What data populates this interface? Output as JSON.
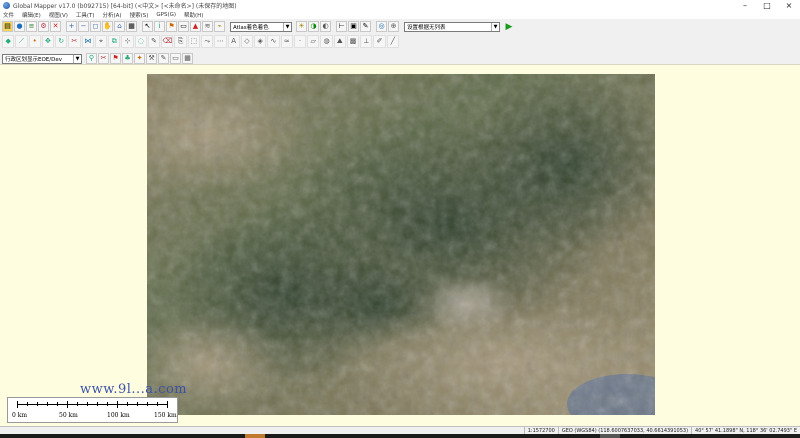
{
  "window": {
    "title": "Global Mapper v17.0 (b092715) [64-bit] (<中文> [<未命名>] (未保存的地图)"
  },
  "menu": [
    {
      "label": "文件"
    },
    {
      "label": "编辑(E)"
    },
    {
      "label": "视图(V)"
    },
    {
      "label": "工具(T)"
    },
    {
      "label": "分析(A)"
    },
    {
      "label": "搜索(S)"
    },
    {
      "label": "GPS(G)"
    },
    {
      "label": "帮助(H)"
    }
  ],
  "toolbar1": {
    "left_icons": [
      "open-folder-icon",
      "globe-icon",
      "layers-icon",
      "config-icon",
      "exit-icon",
      "zoom-in-icon",
      "zoom-out-icon",
      "zoom-box-icon",
      "pan-icon",
      "full-view-icon",
      "select-icon",
      "info-icon",
      "measure-icon",
      "grid-icon",
      "print-icon",
      "3d-view-icon",
      "shader-icon",
      "path-profile-icon"
    ],
    "shader_select": "Atlas着色着色",
    "mid_icons": [
      "lighting-icon",
      "hsv-icon",
      "contrast-icon",
      "feature-info-icon",
      "image-icon",
      "digitize-icon",
      "spot-icon",
      "spot-2-icon"
    ],
    "layer_select": "设置根据无列表",
    "play_icon": "play-icon"
  },
  "toolbar2": {
    "icons": [
      "create-area-icon",
      "create-line-icon",
      "create-point-icon",
      "move-icon",
      "rotate-icon",
      "split-icon",
      "join-icon",
      "vertex-icon",
      "crop-icon",
      "snap-icon",
      "buffer-icon",
      "edit-icon",
      "delete-icon",
      "copy-icon",
      "measure-area-icon",
      "path-icon",
      "tracks-icon",
      "label-icon",
      "feature-icon",
      "style-icon",
      "curve-icon",
      "smooth-icon",
      "point-icon",
      "area-icon",
      "contour-icon",
      "terrain-icon",
      "volume-icon",
      "cut-icon",
      "pen-icon",
      "line-tool-icon",
      "draw-icon",
      "pencil-icon"
    ]
  },
  "toolbar3": {
    "projection_select": "行政区划显示EOE/Dev",
    "icons": [
      "pin-icon",
      "scissors-icon",
      "flag-icon",
      "tree-icon",
      "marker-icon",
      "tool-icon",
      "edit-2-icon",
      "window-icon",
      "grid-icon-2"
    ]
  },
  "watermark": "www.9l...a.com",
  "scale": {
    "labels": [
      "0 km",
      "50 km",
      "100 km",
      "150 km"
    ]
  },
  "status": {
    "scale": "1:1572700",
    "projection": "GEO (WGS84) (118.6007637033, 40.6614391053)",
    "coords": "40° 57' 41.1898\" N, 118° 36' 02.7493\" E"
  },
  "colors": {
    "workspace_bg": "#fffde0",
    "watermark": "#3b52a8",
    "play": "#1a9a1a"
  }
}
